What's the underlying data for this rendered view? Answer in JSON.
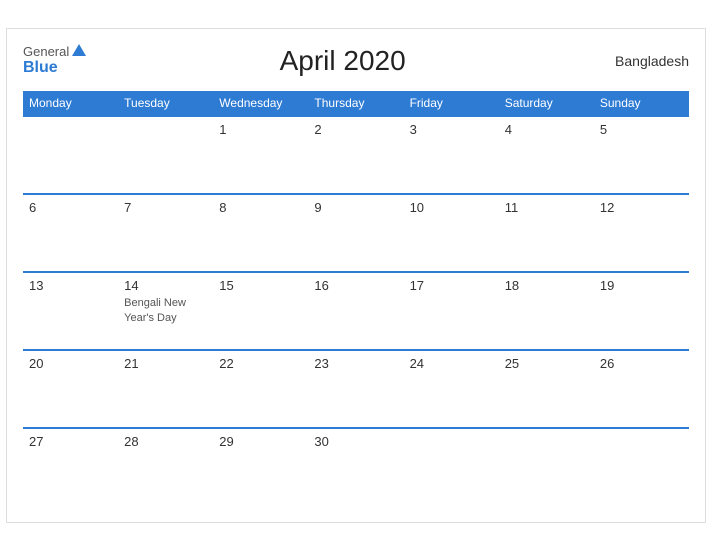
{
  "logo": {
    "general": "General",
    "blue": "Blue"
  },
  "header": {
    "title": "April 2020",
    "country": "Bangladesh"
  },
  "weekdays": [
    "Monday",
    "Tuesday",
    "Wednesday",
    "Thursday",
    "Friday",
    "Saturday",
    "Sunday"
  ],
  "weeks": [
    [
      {
        "day": "",
        "empty": true
      },
      {
        "day": "",
        "empty": true
      },
      {
        "day": "1"
      },
      {
        "day": "2"
      },
      {
        "day": "3"
      },
      {
        "day": "4"
      },
      {
        "day": "5"
      }
    ],
    [
      {
        "day": "6"
      },
      {
        "day": "7"
      },
      {
        "day": "8"
      },
      {
        "day": "9"
      },
      {
        "day": "10"
      },
      {
        "day": "11"
      },
      {
        "day": "12"
      }
    ],
    [
      {
        "day": "13"
      },
      {
        "day": "14",
        "holiday": "Bengali New Year's Day"
      },
      {
        "day": "15"
      },
      {
        "day": "16"
      },
      {
        "day": "17"
      },
      {
        "day": "18"
      },
      {
        "day": "19"
      }
    ],
    [
      {
        "day": "20"
      },
      {
        "day": "21"
      },
      {
        "day": "22"
      },
      {
        "day": "23"
      },
      {
        "day": "24"
      },
      {
        "day": "25"
      },
      {
        "day": "26"
      }
    ],
    [
      {
        "day": "27"
      },
      {
        "day": "28"
      },
      {
        "day": "29"
      },
      {
        "day": "30"
      },
      {
        "day": "",
        "empty": true
      },
      {
        "day": "",
        "empty": true
      },
      {
        "day": "",
        "empty": true
      }
    ]
  ]
}
